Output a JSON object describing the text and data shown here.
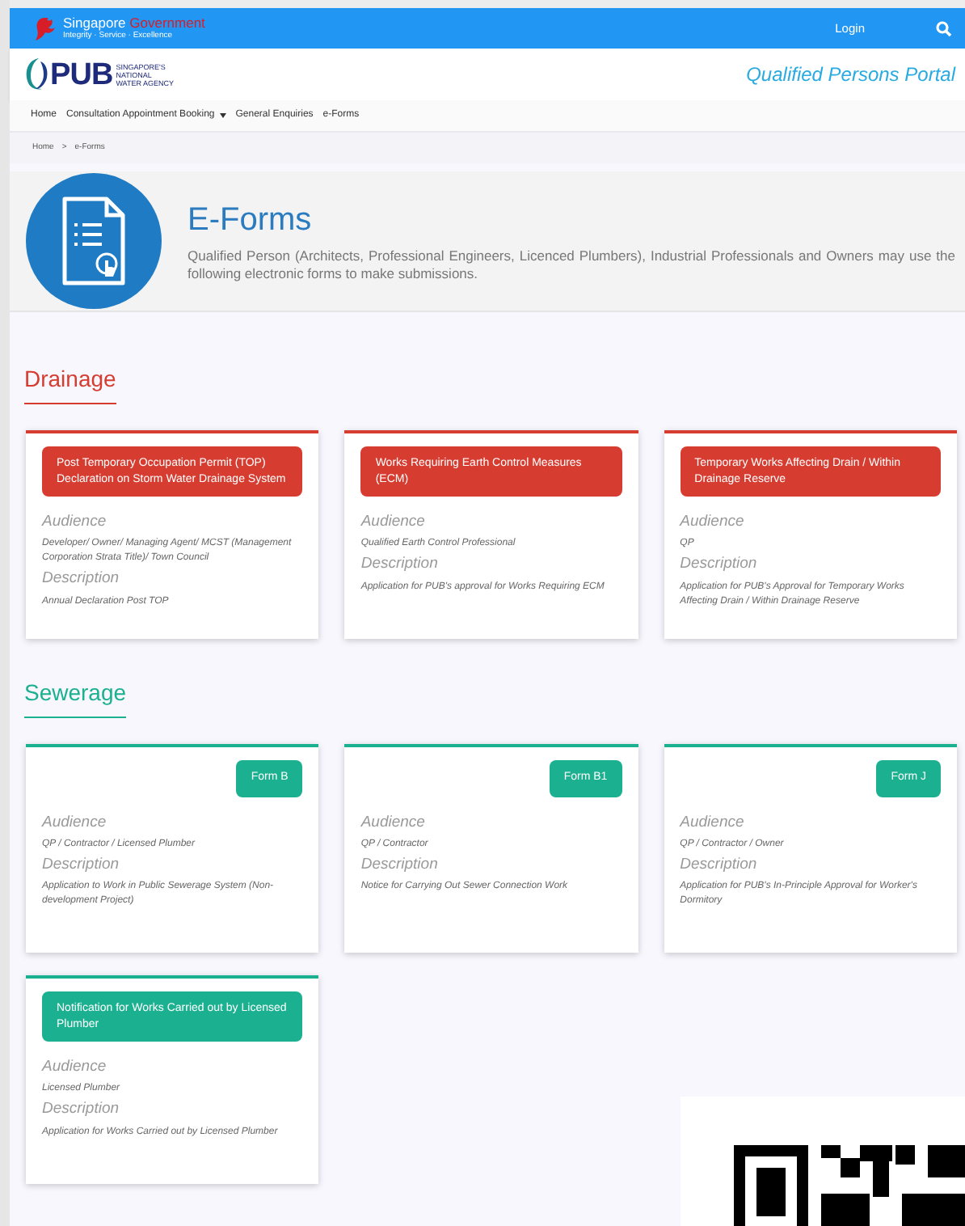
{
  "gov_bar": {
    "name_first": "Singapore",
    "name_second": "Government",
    "motto": "Integrity · Service · Excellence",
    "login": "Login"
  },
  "header": {
    "logo_text": "PUB",
    "logo_tagline": [
      "SINGAPORE'S",
      "NATIONAL",
      "WATER AGENCY"
    ],
    "portal_title": "Qualified Persons Portal"
  },
  "nav": [
    {
      "label": "Home",
      "kind": "link"
    },
    {
      "label": "Consultation Appointment Booking",
      "kind": "dropdown"
    },
    {
      "label": "General Enquiries",
      "kind": "link"
    },
    {
      "label": "e-Forms",
      "kind": "link"
    }
  ],
  "breadcrumb": {
    "items": [
      "Home",
      "e-Forms"
    ],
    "separator": ">"
  },
  "banner": {
    "title": "E-Forms",
    "text": "Qualified Person (Architects, Professional Engineers, Licenced Plumbers), Industrial Professionals and Owners may use the following electronic forms to make submissions."
  },
  "sections": [
    {
      "title": "Drainage",
      "color": "#d63c30",
      "cards": [
        {
          "kind": "title",
          "form": "Post Temporary Occupation Permit (TOP) Declaration on Storm Water Drainage System",
          "audience_label": "Audience",
          "audience": "Developer/ Owner/ Managing Agent/ MCST (Management Corporation Strata Title)/ Town Council",
          "description_label": "Description",
          "description": "Annual Declaration Post TOP"
        },
        {
          "kind": "title",
          "form": "Works Requiring Earth Control Measures (ECM)",
          "audience_label": "Audience",
          "audience": "Qualified Earth Control Professional",
          "description_label": "Description",
          "description": "Application for PUB's approval for Works Requiring ECM"
        },
        {
          "kind": "title",
          "form": "Temporary Works Affecting Drain / Within Drainage Reserve",
          "audience_label": "Audience",
          "audience": "QP",
          "description_label": "Description",
          "description": "Application for PUB's Approval for Temporary Works Affecting Drain / Within Drainage Reserve"
        }
      ]
    },
    {
      "title": "Sewerage",
      "color": "#1bb08f",
      "cards": [
        {
          "kind": "badge",
          "form": "Form B",
          "audience_label": "Audience",
          "audience": "QP / Contractor / Licensed Plumber",
          "description_label": "Description",
          "description": "Application to Work in Public Sewerage System (Non-development Project)"
        },
        {
          "kind": "badge",
          "form": "Form B1",
          "audience_label": "Audience",
          "audience": "QP / Contractor",
          "description_label": "Description",
          "description": "Notice for Carrying Out Sewer Connection Work"
        },
        {
          "kind": "badge",
          "form": "Form J",
          "audience_label": "Audience",
          "audience": "QP / Contractor / Owner",
          "description_label": "Description",
          "description": "Application for PUB's In-Principle Approval for Worker's Dormitory"
        },
        {
          "kind": "title",
          "form": "Notification for Works Carried out by Licensed Plumber",
          "audience_label": "Audience",
          "audience": "Licensed Plumber",
          "description_label": "Description",
          "description": "Application for Works Carried out by Licensed Plumber"
        }
      ]
    }
  ]
}
